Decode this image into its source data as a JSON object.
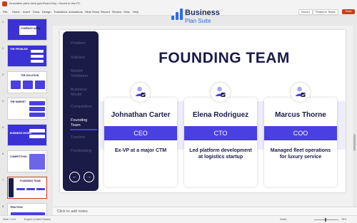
{
  "titlebar": {
    "doc_title": "Innovative-pitch-deck.pptx",
    "status": "Read-Only • Saved to this PC"
  },
  "menu": {
    "items": [
      "File",
      "Home",
      "Insert",
      "Draw",
      "Design",
      "Transitions",
      "Animations",
      "Slide Show",
      "Record",
      "Review",
      "View",
      "Help"
    ],
    "record_label": "Record",
    "present_label": "Present in Teams",
    "share_label": "Share"
  },
  "brand": {
    "line1": "Business",
    "line2": "Plan Suite"
  },
  "thumbnails": [
    {
      "num": "1",
      "title": "COMPANY NAME",
      "style": "dark"
    },
    {
      "num": "2",
      "title": "THE PROBLEM",
      "style": "dark"
    },
    {
      "num": "3",
      "title": "THE SOLUTION",
      "style": "light"
    },
    {
      "num": "4",
      "title": "THE MARKET",
      "style": "light"
    },
    {
      "num": "5",
      "title": "BUSINESS MODEL",
      "style": "dark"
    },
    {
      "num": "6",
      "title": "COMPETITION",
      "style": "light"
    },
    {
      "num": "7",
      "title": "FOUNDING TEAM",
      "style": "light"
    },
    {
      "num": "8",
      "title": "TRACTION",
      "style": "light"
    }
  ],
  "slide": {
    "title": "FOUNDING TEAM",
    "nav": [
      "Problem",
      "Solution",
      "Market Validation",
      "Business Model",
      "Competition",
      "Founding Team",
      "Traction",
      "Fundraising"
    ],
    "active_nav": "Founding Team",
    "prev_arrow": "←",
    "next_arrow": "→",
    "cards": [
      {
        "name": "Johnathan Carter",
        "role": "CEO",
        "desc": "Ex-VP at a major CTM"
      },
      {
        "name": "Elena Rodriguez",
        "role": "CTO",
        "desc": "Led platform development at logistics startup"
      },
      {
        "name": "Marcus Thorne",
        "role": "COO",
        "desc": "Managed fleet operations for luxury service"
      }
    ],
    "accent": "#4a3fe0",
    "dark": "#1a1b46"
  },
  "notes": {
    "placeholder": "Click to add notes"
  },
  "status": {
    "slide": "Slide 7 of 8",
    "language": "English (United States)",
    "notes": "Notes",
    "zoom": "78%"
  }
}
